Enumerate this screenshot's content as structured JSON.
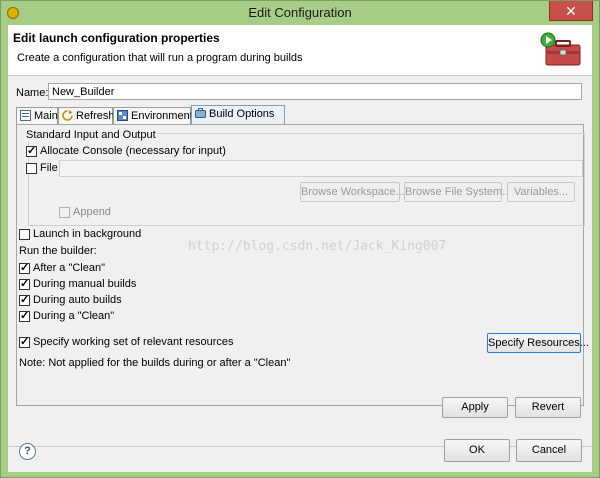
{
  "window": {
    "title": "Edit Configuration",
    "close_label": "✕"
  },
  "header": {
    "title": "Edit launch configuration properties",
    "description": "Create a configuration that will run a program during builds"
  },
  "name_field": {
    "label": "Name:",
    "value": "New_Builder"
  },
  "tabs": [
    {
      "label": "Main",
      "active": false
    },
    {
      "label": "Refresh",
      "active": false
    },
    {
      "label": "Environment",
      "active": false
    },
    {
      "label": "Build Options",
      "active": true
    }
  ],
  "build_options": {
    "standard_io": {
      "group_label": "Standard Input and Output",
      "allocate_console": {
        "label": "Allocate Console (necessary for input)",
        "checked": true
      },
      "file": {
        "label": "File",
        "checked": false,
        "value": ""
      },
      "browse_workspace": "Browse Workspace...",
      "browse_file_system": "Browse File System...",
      "variables": "Variables...",
      "append": {
        "label": "Append",
        "checked": false
      }
    },
    "launch_background": {
      "label": "Launch in background",
      "checked": false
    },
    "run_builder_label": "Run the builder:",
    "after_clean": {
      "label": "After a \"Clean\"",
      "checked": true
    },
    "manual_builds": {
      "label": "During manual builds",
      "checked": true
    },
    "auto_builds": {
      "label": "During auto builds",
      "checked": true
    },
    "during_clean": {
      "label": "During a \"Clean\"",
      "checked": true
    },
    "working_set": {
      "label": "Specify working set of relevant resources",
      "checked": true
    },
    "specify_resources": "Specify Resources...",
    "note": "Note: Not applied for the builds during or after a \"Clean\""
  },
  "watermark": "http://blog.csdn.net/Jack_King007",
  "buttons": {
    "apply": "Apply",
    "revert": "Revert",
    "ok": "OK",
    "cancel": "Cancel",
    "help": "?"
  }
}
